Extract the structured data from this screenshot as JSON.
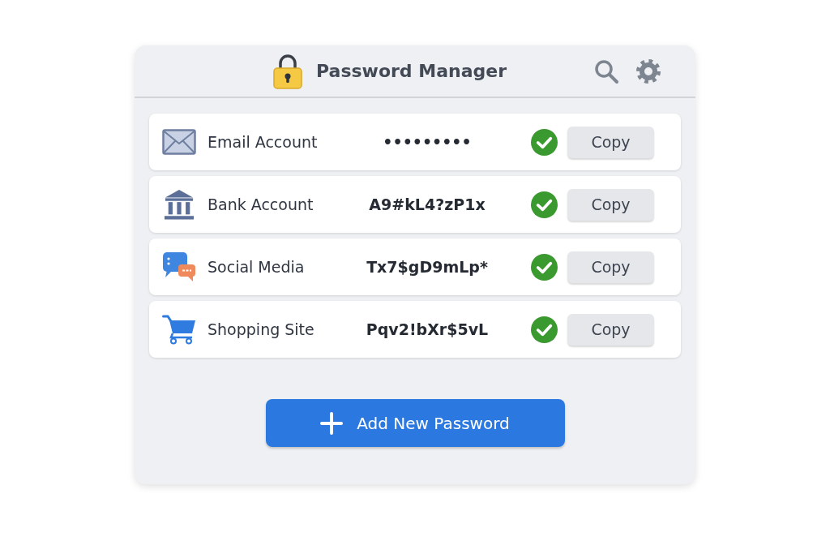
{
  "window": {
    "title": "Password Manager"
  },
  "entries": [
    {
      "kind": "email",
      "name": "Email Account",
      "password": "•••••••••",
      "verified": true,
      "button": "Copy"
    },
    {
      "kind": "bank",
      "name": "Bank Account",
      "password": "A9#kL4?zP1x",
      "verified": true,
      "button": "Copy"
    },
    {
      "kind": "social",
      "name": "Social Media",
      "password": "Tx7$gD9mLp*",
      "verified": true,
      "button": "Copy"
    },
    {
      "kind": "shopping",
      "name": "Shopping Site",
      "password": "Pqv2!bXr$5vL",
      "verified": true,
      "button": "Copy"
    }
  ],
  "add_button": {
    "label": "Add New Password"
  }
}
